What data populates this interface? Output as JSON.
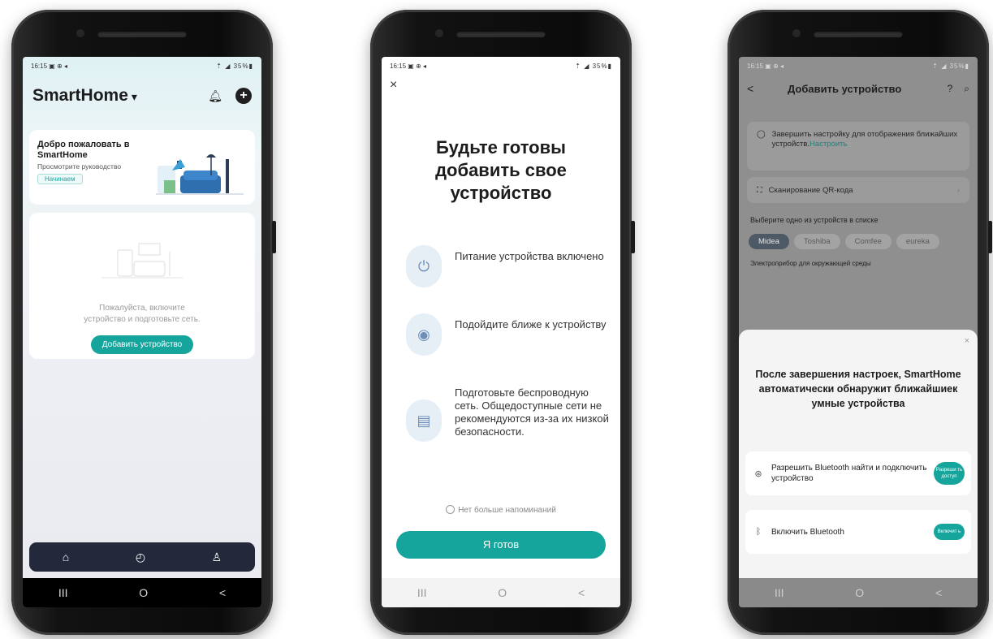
{
  "phone1": {
    "status": {
      "time": "16:15 ▣ ⊕ ◂",
      "right": "⇡ ◢ 35%▮"
    },
    "app_title": "SmartHome",
    "welcome": {
      "title": "Добро пожаловать в SmartHome",
      "desc": "Просмотрите руководство",
      "start": "Начинаем"
    },
    "empty": {
      "text_line1": "Пожалуйста, включите",
      "text_line2": "устройство и подготовьте сеть.",
      "add_button": "Добавить устройство"
    },
    "tabs": [
      "home-icon",
      "clock-icon",
      "profile-icon"
    ],
    "nav": [
      "III",
      "O",
      "<"
    ]
  },
  "phone2": {
    "status": {
      "time": "16:15 ▣ ⊕ ◂",
      "right": "⇡ ◢ 35%▮"
    },
    "close": "×",
    "title_line1": "Будьте готовы",
    "title_line2": "добавить свое",
    "title_line3": "устройство",
    "steps": [
      {
        "icon": "plug-icon",
        "text": "Питание устройства включено"
      },
      {
        "icon": "location-icon",
        "text": "Подойдите ближе к устройству"
      },
      {
        "icon": "router-icon",
        "text": "Подготовьте беспроводную сеть. Общедоступные сети не рекомендуются из-за их низкой безопасности."
      }
    ],
    "no_remind": "Нет больше напоминаний",
    "ready": "Я готов",
    "nav": [
      "III",
      "O",
      "<"
    ]
  },
  "phone3": {
    "status": {
      "time": "16:15 ▣ ⊕ ◂",
      "right": "⇡ ◢ 35%▮"
    },
    "back": "<",
    "title": "Добавить устройство",
    "setup_text": "Завершить настройку для отображения ближайших устройств.",
    "setup_link": "Настроить",
    "qr": "Сканирование QR-кода",
    "choose": "Выберите одно из устройств в списке",
    "brands": [
      "Midea",
      "Toshiba",
      "Comfee",
      "eureka"
    ],
    "category": "Электроприбор для окружающей среды",
    "sheet": {
      "close": "×",
      "title": "После завершения настроек, SmartHome автоматически обнаружит ближайшиек умные устройства",
      "perm1_text": "Разрешить Bluetooth найти и подключить устройство",
      "perm1_btn": "Разреши ть доступ",
      "perm2_text": "Включить Bluetooth",
      "perm2_btn": "Включит ь"
    },
    "nav": [
      "III",
      "O",
      "<"
    ]
  },
  "colors": {
    "accent": "#16a59c",
    "tabbar": "#23283a",
    "dim_overlay": "#8f8f8f"
  }
}
